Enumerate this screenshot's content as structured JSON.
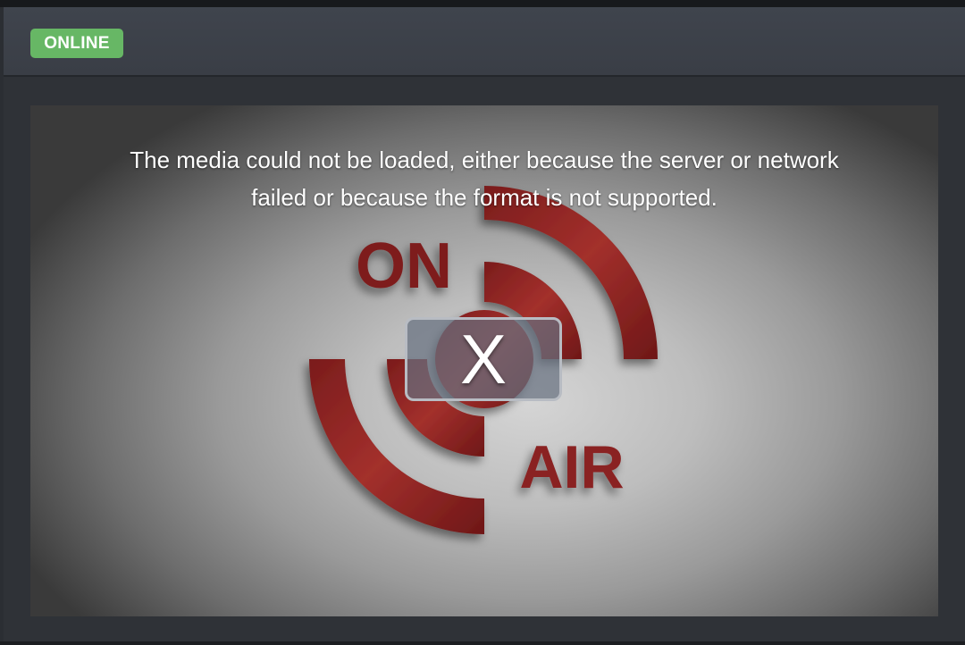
{
  "status_badge": "ONLINE",
  "poster": {
    "word_top": "ON",
    "word_bottom": "AIR"
  },
  "error": {
    "line1": "The media could not be loaded, either because the server or network",
    "line2": "failed or because the format is not supported.",
    "close_glyph": "X"
  },
  "colors": {
    "badge": "#67b765",
    "poster_red": "#8f2323",
    "header": "#3f444d"
  }
}
